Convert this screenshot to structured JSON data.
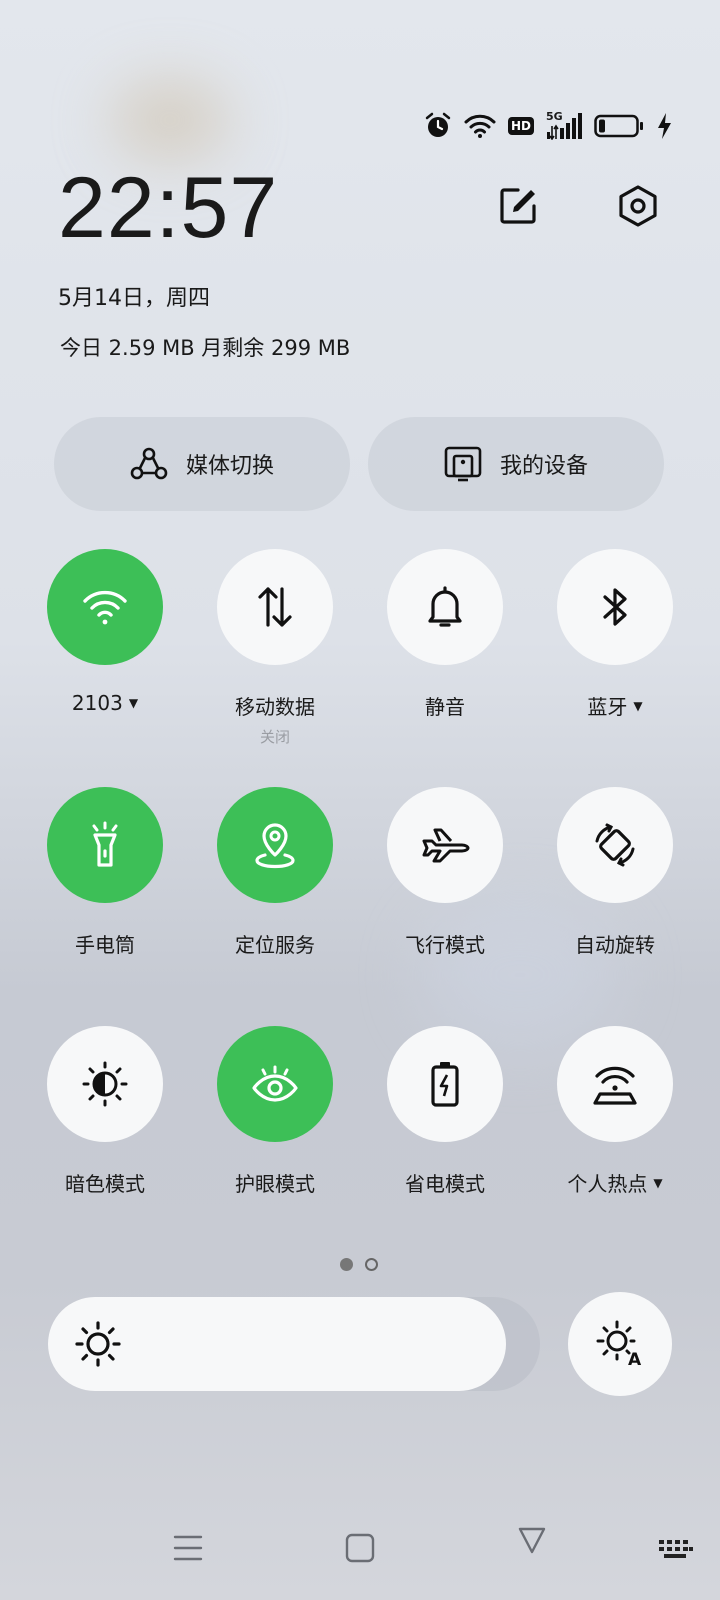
{
  "status": {
    "hd_label": "HD",
    "network_label": "5G"
  },
  "header": {
    "time": "22:57",
    "date": "5月14日，周四",
    "data_usage": "今日 2.59 MB 月剩余 299 MB"
  },
  "pills": {
    "media": "媒体切换",
    "devices": "我的设备"
  },
  "tiles": {
    "wifi": {
      "label": "2103",
      "active": true
    },
    "mobile_data": {
      "label": "移动数据",
      "sub": "关闭",
      "active": false
    },
    "mute": {
      "label": "静音",
      "active": false
    },
    "bluetooth": {
      "label": "蓝牙",
      "active": false
    },
    "flashlight": {
      "label": "手电筒",
      "active": true
    },
    "location": {
      "label": "定位服务",
      "active": true
    },
    "airplane": {
      "label": "飞行模式",
      "active": false
    },
    "auto_rotate": {
      "label": "自动旋转",
      "active": false
    },
    "dark_mode": {
      "label": "暗色模式",
      "active": false
    },
    "eye_care": {
      "label": "护眼模式",
      "active": true
    },
    "power_save": {
      "label": "省电模式",
      "active": false
    },
    "hotspot": {
      "label": "个人热点",
      "active": false
    }
  },
  "page_indicator": {
    "current": 1,
    "total": 2
  },
  "brightness": {
    "level": 0.93
  },
  "colors": {
    "active_tile": "#3dbf57",
    "inactive_tile": "#f7f8f9",
    "text": "#1a1a1a"
  }
}
